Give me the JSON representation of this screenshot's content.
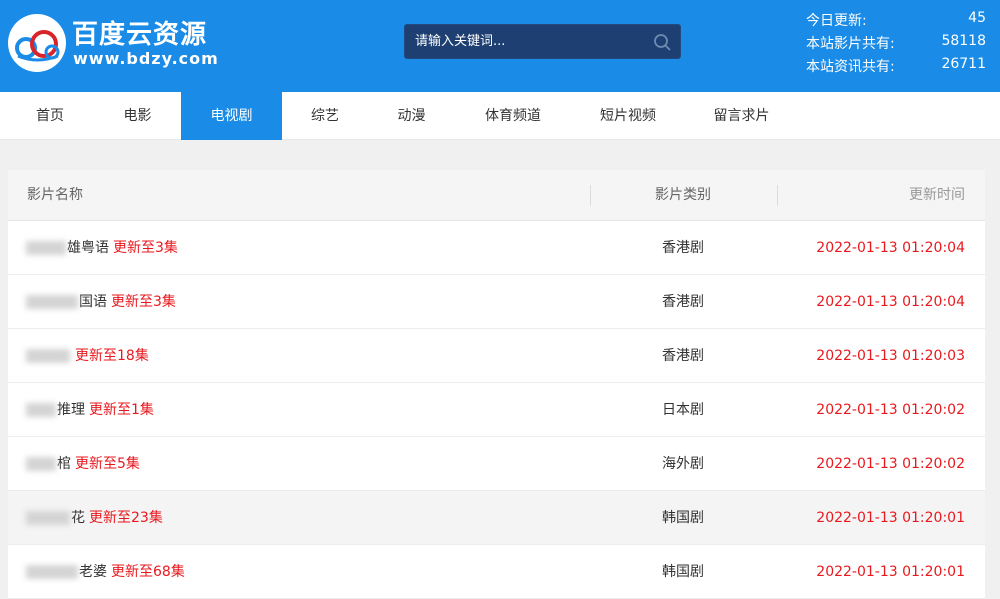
{
  "header": {
    "site_title": "百度云资源",
    "site_url": "www.bdzy.com",
    "search_placeholder": "请输入关键词...",
    "stats": [
      {
        "label": "今日更新:",
        "value": "45"
      },
      {
        "label": "本站影片共有:",
        "value": "58118"
      },
      {
        "label": "本站资讯共有:",
        "value": "26711"
      }
    ],
    "colors": {
      "bar": "#1a8be6",
      "search_bg": "#1d3f72"
    }
  },
  "nav": {
    "items": [
      {
        "label": "首页"
      },
      {
        "label": "电影"
      },
      {
        "label": "电视剧",
        "active": true
      },
      {
        "label": "综艺"
      },
      {
        "label": "动漫"
      },
      {
        "label": "体育频道"
      },
      {
        "label": "短片视频"
      },
      {
        "label": "留言求片"
      }
    ]
  },
  "table": {
    "columns": [
      "影片名称",
      "影片类别",
      "更新时间"
    ],
    "rows": [
      {
        "title": "雄粤语",
        "update": "更新至3集",
        "category": "香港剧",
        "time": "2022-01-13 01:20:04"
      },
      {
        "title": "国语",
        "update": "更新至3集",
        "category": "香港剧",
        "time": "2022-01-13 01:20:04"
      },
      {
        "title": "",
        "update": "更新至18集",
        "category": "香港剧",
        "time": "2022-01-13 01:20:03"
      },
      {
        "title": "推理",
        "update": "更新至1集",
        "category": "日本剧",
        "time": "2022-01-13 01:20:02"
      },
      {
        "title": "棺",
        "update": "更新至5集",
        "category": "海外剧",
        "time": "2022-01-13 01:20:02"
      },
      {
        "title": "花",
        "update": "更新至23集",
        "category": "韩国剧",
        "time": "2022-01-13 01:20:01"
      },
      {
        "title": "老婆",
        "update": "更新至68集",
        "category": "韩国剧",
        "time": "2022-01-13 01:20:01"
      }
    ],
    "colors": {
      "accent": "#e8191e",
      "highlight_row": "#f4f4f4"
    }
  }
}
